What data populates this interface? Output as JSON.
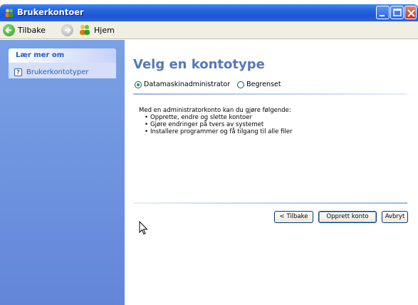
{
  "window": {
    "title": "Brukerkontoer"
  },
  "toolbar": {
    "back_label": "Tilbake",
    "home_label": "Hjem"
  },
  "sidebar": {
    "heading": "Lær mer om",
    "items": [
      {
        "label": "Brukerkontotyper",
        "icon": "help-icon"
      }
    ]
  },
  "main": {
    "title": "Velg en kontotype",
    "options": [
      {
        "label": "Datamaskinadministrator",
        "selected": true
      },
      {
        "label": "Begrenset",
        "selected": false
      }
    ],
    "description": "Med en administratorkonto kan du gjøre følgende:",
    "bullets": [
      "Opprette, endre og slette kontoer",
      "Gjøre endringer på tvers av systemet",
      "Installere programmer og få tilgang til alle filer"
    ],
    "buttons": {
      "back": "< Tilbake",
      "create": "Opprett konto",
      "cancel": "Avbryt"
    }
  },
  "colors": {
    "titlebar": "#2a66e0",
    "sidebar": "#6386d8",
    "heading": "#5579b9",
    "link": "#215dc6"
  }
}
